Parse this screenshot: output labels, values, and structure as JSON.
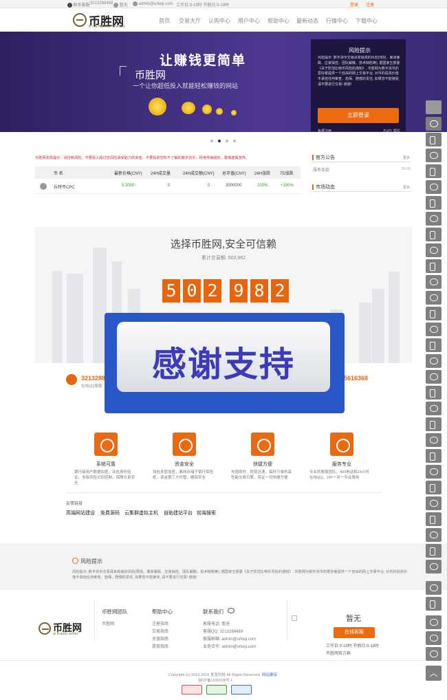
{
  "topbar": {
    "service": "联系客服",
    "qq": "3213288469",
    "phone": "暂无",
    "email": "admin@urkeji.com",
    "hours": "工作日:9-19时 节假日:9-18时",
    "login": "登录",
    "register": "注册"
  },
  "header": {
    "logo_cn": "币胜网",
    "logo_en": "BI SHENG WANG",
    "nav": [
      "首页",
      "交易大厅",
      "认购中心",
      "用户中心",
      "帮助中心",
      "最新动态",
      "行情中心",
      "下载中心"
    ]
  },
  "banner": {
    "slogan": "让赚钱更简单",
    "title": "币胜网",
    "subtitle": "一个让你超低投入就能轻松赚钱的网站",
    "risk_title": "风险提示",
    "risk_text": "风险提示: 数字货币交易具有极高的风险(预挖、暴涨暴跌、庄家操控、团队解散、技术缺陷等), 据国家五部委《关于防范比特币风险的通知》, 币胜网为数字货币的爱好者提供一个自由的网上交易平台, 对币的投资价值不承担任何审查、担保、赔偿的责任, 如果您不能接受, 请不要进行交易! 谢谢!",
    "login_btn": "立即登录",
    "bottom_left": "免费注册",
    "bottom_right": "忘记？帮忙"
  },
  "notice": "币胜网友情提示：请控制风险，不要投入超过您风险承受能力的资金，不要投资您所不了解的数字货币，拒绝传销组织，警惕虚假宣传。",
  "market": {
    "headers": [
      "币 名",
      "最新价格(CNY)",
      "24H成交量",
      "24H成交额(CNY)",
      "总市值(CNY)",
      "24H涨跌",
      "7D涨跌"
    ],
    "rows": [
      {
        "name": "丘特币CPC",
        "price": "0.3000↑",
        "vol": "0",
        "amount": "0",
        "cap": "3000000",
        "d24": "100%",
        "d7": "+100%"
      }
    ]
  },
  "sidebar": {
    "announce_title": "官方公告",
    "more": "更多",
    "announce_item": "服务条款",
    "announce_date": "05-08",
    "news_title": "市场动态"
  },
  "stats": {
    "title": "选择币胜网,安全可信赖",
    "subtitle": "累计交易额: 502,982",
    "digits": [
      "5",
      "0",
      "2",
      "9",
      "8",
      "2"
    ],
    "contact_qq_left": "3213288",
    "contact_left_sub": "在线QQ客服",
    "contact_right": "5616368"
  },
  "overlay_text": "感谢支持",
  "features": [
    {
      "title": "系统可靠",
      "desc": "银行级用户数据加密、动态身份验证，多级风险识别控制，保障交易安全"
    },
    {
      "title": "资金安全",
      "desc": "钱包多层加密，离线存储于银行保险柜，资金第三方托管，确保安全"
    },
    {
      "title": "快捷方便",
      "desc": "充值即时、提现迅速，每秒万单的高性能交易引擎，保证一切快捷方便"
    },
    {
      "title": "服务专业",
      "desc": "专业的客服团队，400电话和24小时在线QQ，VIP一对一专业服务"
    }
  ],
  "friend_links": {
    "title": "友情链接",
    "items": [
      "高端网站建设",
      "免费源码",
      "云集群虚拟主机",
      "自助建站平台",
      "前端搜索"
    ]
  },
  "risk_footer": {
    "title": "风险提示",
    "text": "风险提示: 数字货币交易具有极高的风险(预挖、暴涨暴跌、庄家操控、团队解散、技术缺陷等), 据国家五部委《关于防范比特币风险的通知》, 币胜网为数字货币的爱好者提供一个自由的网上交易平台, 对币的投资价值不承担任何审查、担保、赔偿的责任, 如果您不能接受, 请不要进行交易! 谢谢!"
  },
  "footer": {
    "team_title": "币胜网团队",
    "team_items": [
      "币胜网"
    ],
    "help_title": "帮助中心",
    "help_items": [
      "注册指南",
      "交易指南",
      "充值指南",
      "提现指南"
    ],
    "contact_title": "联系我们",
    "contact_items": [
      "客服电话: 暂无",
      "客服QQ: 3213288469",
      "客服邮箱: admin@urkeji.com",
      "业务合作: admin@urkeji.com"
    ],
    "phone": "暂无",
    "online_btn": "在线客服",
    "hours": "工作日:9-19时 节假日:9-18时",
    "official_group": "币胜网官方群",
    "copyright": "Copyright (c) 2013-2016 发宝科技 All Rights Reserved.",
    "copyright_link": "网站建设",
    "icp": "鄂ICP备13052038号-1"
  }
}
